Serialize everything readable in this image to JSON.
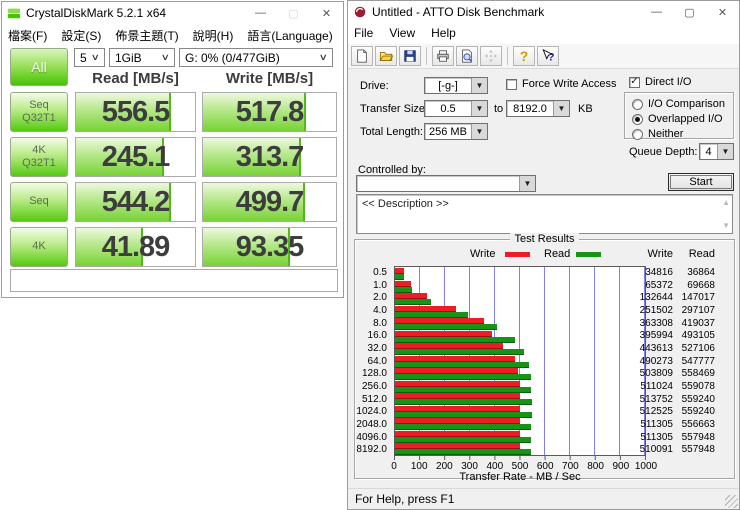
{
  "cdm": {
    "title": "CrystalDiskMark 5.2.1 x64",
    "menu": [
      "檔案(F)",
      "設定(S)",
      "佈景主題(T)",
      "說明(H)",
      "語言(Language)"
    ],
    "selects": {
      "test_count": "5",
      "test_size": "1GiB",
      "target_drive": "G: 0% (0/477GiB)"
    },
    "all_button": "All",
    "headers": {
      "read": "Read [MB/s]",
      "write": "Write [MB/s]"
    },
    "rows": [
      {
        "label": "Seq\nQ32T1",
        "read": "556.5",
        "write": "517.8",
        "read_pct": 78,
        "write_pct": 76
      },
      {
        "label": "4K\nQ32T1",
        "read": "245.1",
        "write": "313.7",
        "read_pct": 72,
        "write_pct": 72
      },
      {
        "label": "Seq",
        "read": "544.2",
        "write": "499.7",
        "read_pct": 78,
        "write_pct": 75
      },
      {
        "label": "4K",
        "read": "41.89",
        "write": "93.35",
        "read_pct": 55,
        "write_pct": 64
      }
    ],
    "comment": "",
    "colors": {
      "button_green": "#55ca10",
      "fill_green": "#78d335"
    }
  },
  "atto": {
    "title": "Untitled - ATTO Disk Benchmark",
    "menu": [
      "File",
      "View",
      "Help"
    ],
    "toolbar_icons": [
      "new",
      "open",
      "save",
      "print",
      "print-preview",
      "move",
      "help",
      "context-help"
    ],
    "form": {
      "drive_label": "Drive:",
      "drive_value": "[-g-]",
      "force_write_access_label": "Force Write Access",
      "force_write_access_checked": false,
      "direct_io_label": "Direct I/O",
      "direct_io_checked": true,
      "transfer_size_label": "Transfer Size:",
      "transfer_from": "0.5",
      "to_label": "to",
      "transfer_to": "8192.0",
      "kb_label": "KB",
      "total_length_label": "Total Length:",
      "total_length_value": "256 MB",
      "radio_options": [
        "I/O Comparison",
        "Overlapped I/O",
        "Neither"
      ],
      "radio_selected": "Overlapped I/O",
      "queue_depth_label": "Queue Depth:",
      "queue_depth_value": "4",
      "controlled_by_label": "Controlled by:",
      "controlled_by_value": "",
      "start_button": "Start",
      "description_placeholder": "<< Description >>"
    },
    "status": "For Help, press F1"
  },
  "chart_data": {
    "type": "bar",
    "title": "Test Results",
    "orientation": "horizontal",
    "categories": [
      "0.5",
      "1.0",
      "2.0",
      "4.0",
      "8.0",
      "16.0",
      "32.0",
      "64.0",
      "128.0",
      "256.0",
      "512.0",
      "1024.0",
      "2048.0",
      "4096.0",
      "8192.0"
    ],
    "series": [
      {
        "name": "Write",
        "color": "#ee1c25",
        "values": [
          34816,
          65372,
          132644,
          251502,
          363308,
          395994,
          443613,
          490273,
          503809,
          511024,
          513752,
          512525,
          511305,
          511305,
          510091
        ]
      },
      {
        "name": "Read",
        "color": "#169416",
        "values": [
          36864,
          69668,
          147017,
          297107,
          419037,
          493105,
          527106,
          547777,
          558469,
          559078,
          559240,
          559240,
          556663,
          557948,
          557948
        ]
      }
    ],
    "xlabel": "Transfer Rate - MB / Sec",
    "x_ticks": [
      "0",
      "100",
      "200",
      "300",
      "400",
      "500",
      "600",
      "700",
      "800",
      "900",
      "1000"
    ],
    "xlim": [
      0,
      1000
    ],
    "grid": true,
    "gridline_color": "#8080ee",
    "legend_position": "top",
    "legend": [
      {
        "name": "Write",
        "color": "#ee1c25"
      },
      {
        "name": "Read",
        "color": "#169416"
      }
    ]
  }
}
